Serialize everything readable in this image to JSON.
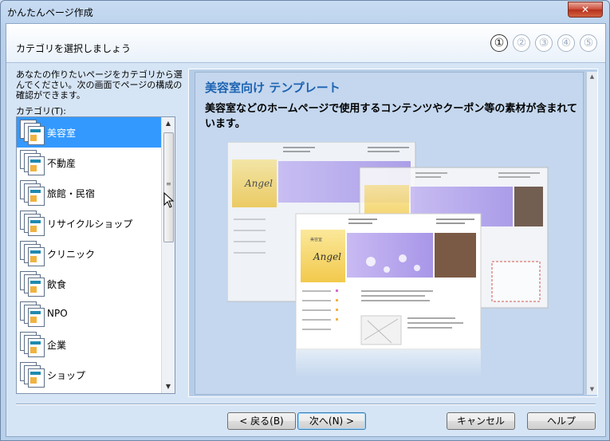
{
  "window": {
    "title": "かんたんページ作成",
    "close_label": "✕"
  },
  "header": {
    "step_title": "カテゴリを選択しましょう",
    "steps": [
      "①",
      "②",
      "③",
      "④",
      "⑤"
    ],
    "active_step": 1
  },
  "left": {
    "description": "あなたの作りたいページをカテゴリから選んでください。次の画面でページの構成の確認ができます。",
    "category_label": "カテゴリ(T):",
    "categories": [
      "美容室",
      "不動産",
      "旅館・民宿",
      "リサイクルショップ",
      "クリニック",
      "飲食",
      "NPO",
      "企業",
      "ショップ"
    ],
    "selected_index": 0
  },
  "preview": {
    "title": "美容室向け テンプレート",
    "description": "美容室などのホームページで使用するコンテンツやクーポン等の素材が含まれています。",
    "brand_text": "Angel",
    "shop_label": "美容室"
  },
  "buttons": {
    "back": "< 戻る(B)",
    "next": "次へ(N) >",
    "cancel": "キャンセル",
    "help": "ヘルプ"
  },
  "colors": {
    "selection": "#3399ff",
    "title_blue": "#1d63b2",
    "brand_purple": "#b7a7ee",
    "brand_yellow": "#f3d54a"
  }
}
